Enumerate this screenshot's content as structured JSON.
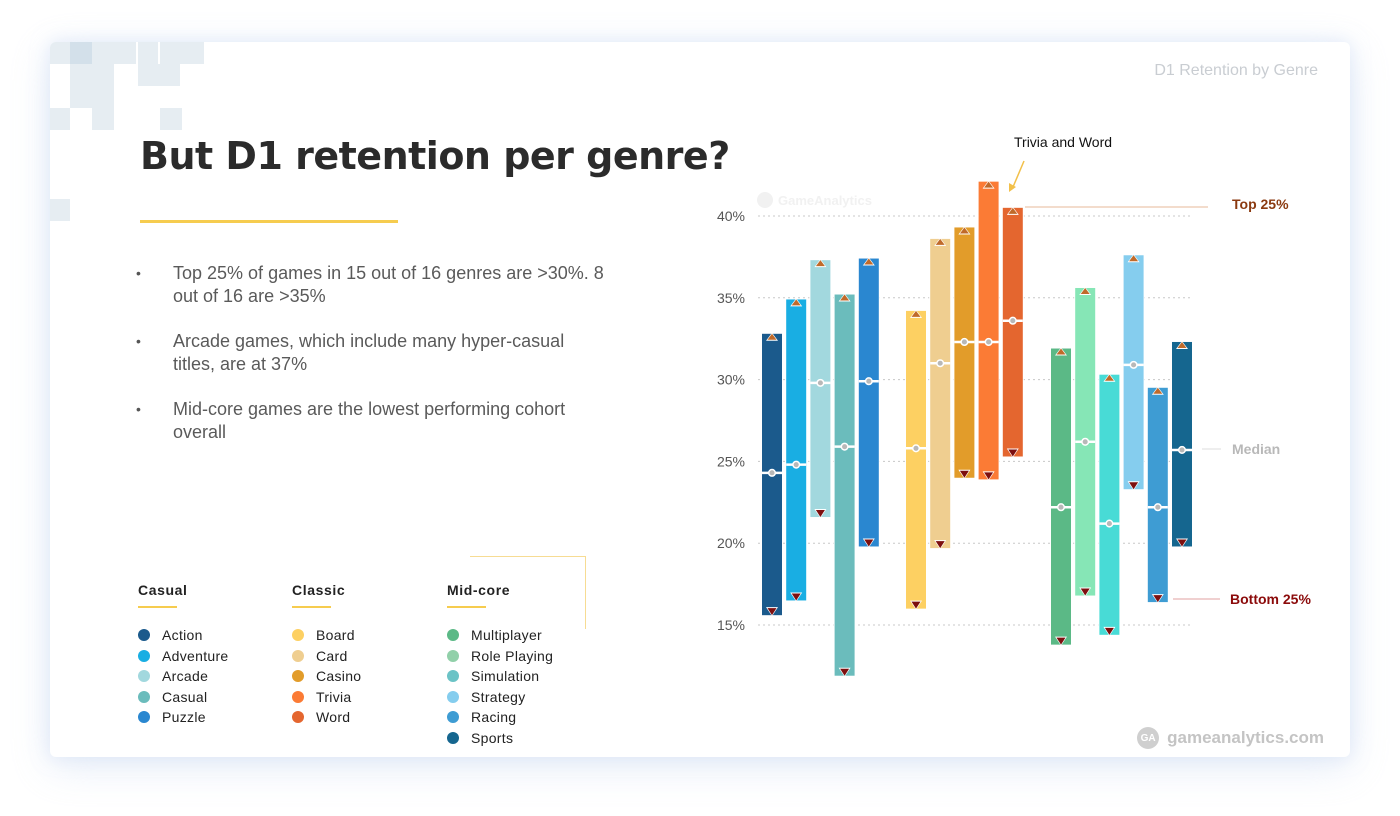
{
  "slide": {
    "tag": "D1 Retention by Genre",
    "title": "But D1 retention per genre?",
    "bullets": [
      "Top 25% of games in 15 out of 16 genres are >30%. 8 out of 16 are >35%",
      "Arcade games, which include many hyper-casual titles, are at 37%",
      "Mid-core games are the lowest performing cohort overall"
    ],
    "bullet_symbol": "•",
    "footer": {
      "logo_text": "GA",
      "site": "gameanalytics.com"
    }
  },
  "legend": {
    "groups": [
      {
        "name": "Casual",
        "items": [
          {
            "label": "Action",
            "color": "#1b5a8c"
          },
          {
            "label": "Adventure",
            "color": "#19aee3"
          },
          {
            "label": "Arcade",
            "color": "#a2d8de"
          },
          {
            "label": "Casual",
            "color": "#6bbcbc"
          },
          {
            "label": "Puzzle",
            "color": "#2a87d0"
          }
        ]
      },
      {
        "name": "Classic",
        "items": [
          {
            "label": "Board",
            "color": "#fdd062"
          },
          {
            "label": "Card",
            "color": "#efce90"
          },
          {
            "label": "Casino",
            "color": "#e29c2a"
          },
          {
            "label": "Trivia",
            "color": "#fb7b35"
          },
          {
            "label": "Word",
            "color": "#e4662f"
          }
        ]
      },
      {
        "name": "Mid-core",
        "items": [
          {
            "label": "Multiplayer",
            "color": "#5bb986"
          },
          {
            "label": "Role Playing",
            "color": "#91d0a9"
          },
          {
            "label": "Simulation",
            "color": "#6bc3c6"
          },
          {
            "label": "Strategy",
            "color": "#85cdee"
          },
          {
            "label": "Racing",
            "color": "#3e9cd3"
          },
          {
            "label": "Sports",
            "color": "#15668f"
          }
        ]
      }
    ]
  },
  "chart_data": {
    "type": "bar",
    "subtype": "floating-range (bottom 25% to top 25% with median)",
    "title": "D1 Retention by Genre",
    "xlabel": "",
    "ylabel": "",
    "ylim": [
      15,
      40
    ],
    "yticks": [
      "40%",
      "35%",
      "30%",
      "25%",
      "20%",
      "15%"
    ],
    "ytick_values": [
      40,
      35,
      30,
      25,
      20,
      15
    ],
    "grid": true,
    "watermark": "GameAnalytics",
    "annotation": "Trivia and Word",
    "marker_legend": {
      "top": "Top 25%",
      "median": "Median",
      "bottom": "Bottom 25%"
    },
    "marker_colors": {
      "top": "#8b3a10",
      "median": "#b8b8b8",
      "bottom": "#8b0a0a",
      "top_triangle": "#c06a2a",
      "bottom_triangle": "#7d0f0f"
    },
    "series": [
      {
        "group": "Casual",
        "name": "Action",
        "color": "#1b5a8c",
        "top": 32.8,
        "median": 24.3,
        "bottom": 15.6
      },
      {
        "group": "Casual",
        "name": "Adventure",
        "color": "#19aee3",
        "top": 34.9,
        "median": 24.8,
        "bottom": 16.5
      },
      {
        "group": "Casual",
        "name": "Arcade",
        "color": "#a2d8de",
        "top": 37.3,
        "median": 29.8,
        "bottom": 21.6
      },
      {
        "group": "Casual",
        "name": "Casual",
        "color": "#6bbcbc",
        "top": 35.2,
        "median": 25.9,
        "bottom": 11.9
      },
      {
        "group": "Casual",
        "name": "Puzzle",
        "color": "#2a87d0",
        "top": 37.4,
        "median": 29.9,
        "bottom": 19.8
      },
      {
        "group": "Classic",
        "name": "Board",
        "color": "#fdd062",
        "top": 34.2,
        "median": 25.8,
        "bottom": 16.0
      },
      {
        "group": "Classic",
        "name": "Card",
        "color": "#efce90",
        "top": 38.6,
        "median": 31.0,
        "bottom": 19.7
      },
      {
        "group": "Classic",
        "name": "Casino",
        "color": "#e29c2a",
        "top": 39.3,
        "median": 32.3,
        "bottom": 24.0
      },
      {
        "group": "Classic",
        "name": "Trivia",
        "color": "#fb7b35",
        "top": 42.1,
        "median": 32.3,
        "bottom": 23.9
      },
      {
        "group": "Classic",
        "name": "Word",
        "color": "#e4662f",
        "top": 40.5,
        "median": 33.6,
        "bottom": 25.3
      },
      {
        "group": "Mid-core",
        "name": "Multiplayer",
        "color": "#5bb986",
        "top": 31.9,
        "median": 22.2,
        "bottom": 13.8
      },
      {
        "group": "Mid-core",
        "name": "Role Playing",
        "color": "#86e6b6",
        "top": 35.6,
        "median": 26.2,
        "bottom": 16.8
      },
      {
        "group": "Mid-core",
        "name": "Simulation",
        "color": "#48dbd6",
        "top": 30.3,
        "median": 21.2,
        "bottom": 14.4
      },
      {
        "group": "Mid-core",
        "name": "Strategy",
        "color": "#85cdee",
        "top": 37.6,
        "median": 30.9,
        "bottom": 23.3
      },
      {
        "group": "Mid-core",
        "name": "Racing",
        "color": "#3e9cd3",
        "top": 29.5,
        "median": 22.2,
        "bottom": 16.4
      },
      {
        "group": "Mid-core",
        "name": "Sports",
        "color": "#15668f",
        "top": 32.3,
        "median": 25.7,
        "bottom": 19.8
      }
    ]
  }
}
